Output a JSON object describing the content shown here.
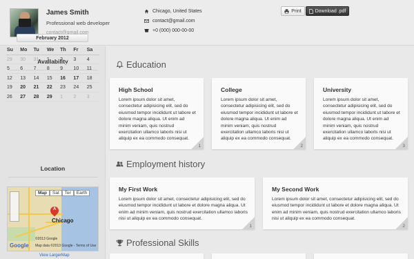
{
  "profile": {
    "name": "James Smith",
    "role": "Professional web developer",
    "email": "contact@gmail.com"
  },
  "contact": {
    "location": "Chicago, United States",
    "email": "contact@gmail.com",
    "phone": "+0 (000) 000-00-00"
  },
  "toolbar": {
    "print_label": "Print",
    "download_label": "Download .pdf"
  },
  "sidebar": {
    "availability_title": "Availability",
    "location_title": "Location",
    "calendar": {
      "month": "February 2012",
      "dow": [
        "Su",
        "Mo",
        "Tu",
        "We",
        "Th",
        "Fr",
        "Sa"
      ],
      "weeks": [
        [
          {
            "d": "29",
            "muted": true
          },
          {
            "d": "30",
            "muted": true
          },
          {
            "d": "31",
            "muted": true
          },
          {
            "d": "1"
          },
          {
            "d": "2"
          },
          {
            "d": "3"
          },
          {
            "d": "4"
          }
        ],
        [
          {
            "d": "5"
          },
          {
            "d": "6"
          },
          {
            "d": "7"
          },
          {
            "d": "8"
          },
          {
            "d": "9"
          },
          {
            "d": "10"
          },
          {
            "d": "11"
          }
        ],
        [
          {
            "d": "12"
          },
          {
            "d": "13"
          },
          {
            "d": "14"
          },
          {
            "d": "15"
          },
          {
            "d": "16",
            "bold": true
          },
          {
            "d": "17",
            "bold": true
          },
          {
            "d": "18"
          }
        ],
        [
          {
            "d": "19"
          },
          {
            "d": "20",
            "bold": true
          },
          {
            "d": "21",
            "bold": true
          },
          {
            "d": "22",
            "bold": true
          },
          {
            "d": "23"
          },
          {
            "d": "24"
          },
          {
            "d": "25"
          }
        ],
        [
          {
            "d": "26"
          },
          {
            "d": "27",
            "bold": true
          },
          {
            "d": "28",
            "bold": true
          },
          {
            "d": "29",
            "bold": true
          },
          {
            "d": "1",
            "muted": true
          },
          {
            "d": "2",
            "muted": true
          },
          {
            "d": "3",
            "muted": true
          }
        ]
      ]
    },
    "map": {
      "types": [
        "Map",
        "Sat",
        "Ter",
        "Earth"
      ],
      "pin_label": "A",
      "city": "Chicago",
      "google": "Google",
      "copyright": "©2013 Google",
      "map_data": "Map data ©2013 Google - Terms of Use",
      "view_larger": "View LargerMap"
    }
  },
  "sections": {
    "education": "Education",
    "employment": "Employment history",
    "skills": "Professional Skills"
  },
  "education": [
    {
      "title": "High School",
      "num": "1",
      "text": "Lorem ipsum dolor sit amet, consectetur adipisicing elit, sed do eiusmod tempor incididunt ut labore et dolore magna aliqua. Ut enim ad minim veniam, quis nostrud exercitation ullamco laboris nisi ut aliquip ex ea commodo consequat."
    },
    {
      "title": "College",
      "num": "2",
      "text": "Lorem ipsum dolor sit amet, consectetur adipisicing elit, sed do eiusmod tempor incididunt ut labore et dolore magna aliqua. Ut enim ad minim veniam, quis nostrud exercitation ullamco laboris nisi ut aliquip ex ea commodo consequat."
    },
    {
      "title": "University",
      "num": "3",
      "text": "Lorem ipsum dolor sit amet, consectetur adipisicing elit, sed do eiusmod tempor incididunt ut labore et dolore magna aliqua. Ut enim ad minim veniam, quis nostrud exercitation ullamco laboris nisi ut aliquip ex ea commodo consequat."
    }
  ],
  "employment": [
    {
      "title": "My First Work",
      "num": "1",
      "text": "Lorem ipsum dolor sit amet, consectetur adipisicing elit, sed do eiusmod tempor incididunt ut labore et dolore magna aliqua. Ut enim ad minim veniam, quis nostrud exercitation ullamco laboris nisi ut aliquip ex ea commodo consequat."
    },
    {
      "title": "My Second Work",
      "num": "2",
      "text": "Lorem ipsum dolor sit amet, consectetur adipisicing elit, sed do eiusmod tempor incididunt ut labore et dolore magna aliqua. Ut enim ad minim veniam, quis nostrud exercitation ullamco laboris nisi ut aliquip ex ea commodo consequat."
    }
  ]
}
